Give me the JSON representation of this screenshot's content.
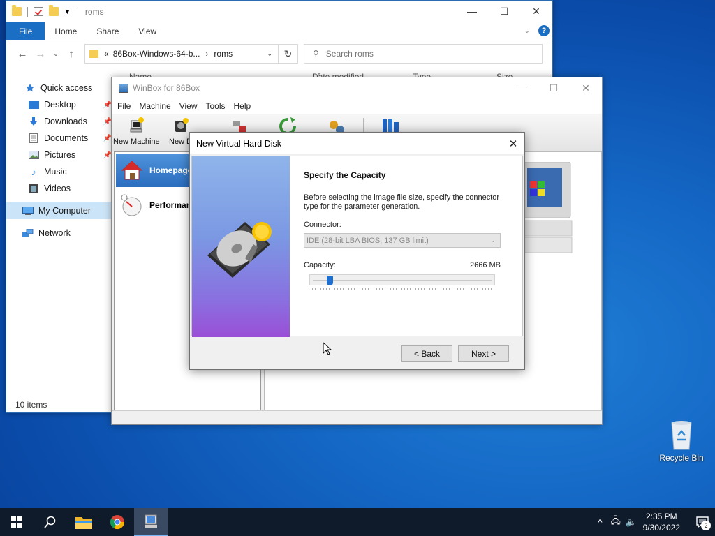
{
  "explorer": {
    "title": "roms",
    "tabs": [
      "File",
      "Home",
      "Share",
      "View"
    ],
    "address": {
      "ellipsis": "«",
      "parent": "86Box-Windows-64-b...",
      "current": "roms"
    },
    "search_placeholder": "Search roms",
    "columns": [
      "Name",
      "Date modified",
      "Type",
      "Size"
    ],
    "nav": [
      {
        "label": "Quick access",
        "icon": "star-icon"
      },
      {
        "label": "Desktop",
        "icon": "desktop-icon",
        "pinned": true
      },
      {
        "label": "Downloads",
        "icon": "download-icon",
        "pinned": true
      },
      {
        "label": "Documents",
        "icon": "document-icon",
        "pinned": true
      },
      {
        "label": "Pictures",
        "icon": "picture-icon",
        "pinned": true
      },
      {
        "label": "Music",
        "icon": "music-icon"
      },
      {
        "label": "Videos",
        "icon": "video-icon"
      },
      {
        "label": "My Computer",
        "icon": "computer-icon",
        "selected": true
      },
      {
        "label": "Network",
        "icon": "network-icon"
      }
    ],
    "status": "10 items"
  },
  "winbox": {
    "title": "WinBox for 86Box",
    "menu": [
      "File",
      "Machine",
      "View",
      "Tools",
      "Help"
    ],
    "toolbar": [
      "New Machine",
      "New D"
    ],
    "left_items": [
      {
        "label": "Homepage",
        "icon": "home-icon",
        "selected": true
      },
      {
        "label": "Performan",
        "icon": "performance-icon"
      }
    ]
  },
  "dialog": {
    "title": "New Virtual Hard Disk",
    "heading": "Specify the Capacity",
    "description": "Before selecting the image file size, specify the connector type for the parameter generation.",
    "connector_label": "Connector:",
    "connector_value": "IDE (28-bit LBA BIOS, 137 GB limit)",
    "capacity_label": "Capacity:",
    "capacity_value": "2666 MB",
    "slider_fraction": 0.08,
    "back_label": "< Back",
    "next_label": "Next >"
  },
  "desktop": {
    "recycle_bin": "Recycle Bin"
  },
  "taskbar": {
    "time": "2:35 PM",
    "date": "9/30/2022",
    "notifications": "2"
  },
  "colors": {
    "accent": "#1a6fc4",
    "selected_nav": "#cce4f7",
    "taskbar": "#0f1a2b"
  }
}
